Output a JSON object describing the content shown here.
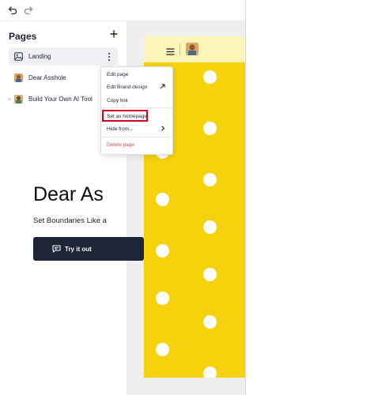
{
  "toolbar": {
    "undo_icon": "undo-icon",
    "redo_icon": "redo-icon"
  },
  "sidebar": {
    "title": "Pages",
    "add_icon": "plus-icon",
    "items": [
      {
        "label": "Landing",
        "icon": "image-icon",
        "active": true
      },
      {
        "label": "Dear Asshole",
        "icon": "avatar-thumbnail",
        "home": true
      },
      {
        "label": "Build Your Own AI Tool",
        "icon": "avatar-thumbnail"
      }
    ]
  },
  "context_menu": {
    "items": [
      {
        "label": "Edit page"
      },
      {
        "label": "Edit Brand design",
        "icon": "arrow-up-right-icon"
      },
      {
        "label": "Copy link"
      },
      {
        "label": "Set as homepage",
        "highlighted": true
      },
      {
        "label": "Hide from...",
        "icon": "chevron-right-icon"
      },
      {
        "label": "Delete page",
        "danger": true
      }
    ]
  },
  "preview": {
    "menu_icon": "hamburger-icon",
    "hero_title": "Dear As",
    "hero_subtitle": "Set Boundaries Like a",
    "cta_label": "Try it out",
    "cta_icon": "chat-icon"
  },
  "colors": {
    "hero_background": "#f5d20b",
    "header_background": "#fdf6b8",
    "cta_background": "#1d2537",
    "highlight_border": "#d0021b",
    "danger_text": "#e5484d",
    "active_item": "#eff0f3"
  }
}
